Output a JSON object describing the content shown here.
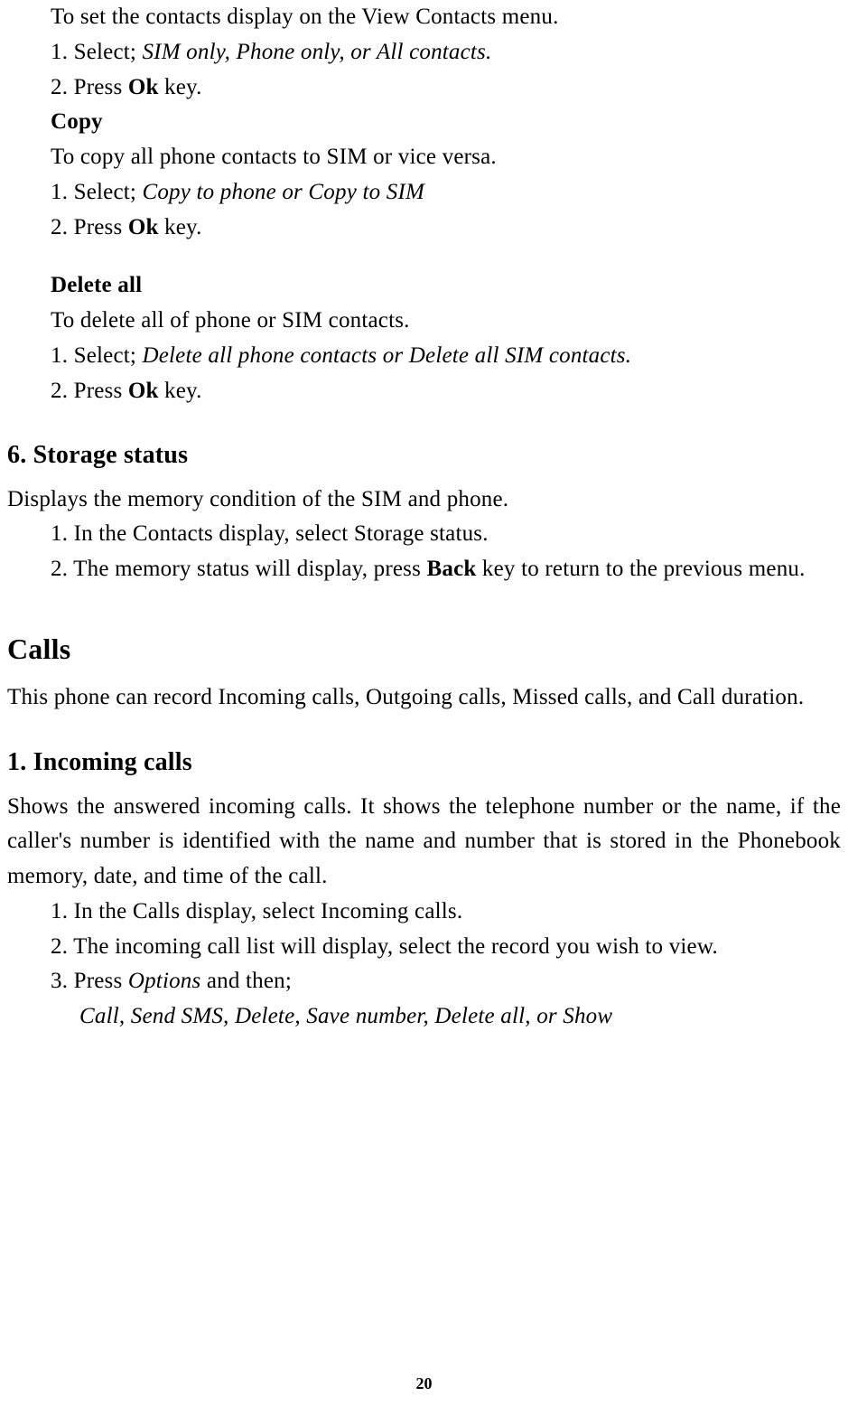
{
  "sec_view": {
    "intro": "To set the contacts display on the View Contacts menu.",
    "s1a": "1. Select; ",
    "s1b": "SIM only, Phone only, or All contacts.",
    "s2a": "2. Press ",
    "s2b": "Ok",
    "s2c": " key."
  },
  "copy": {
    "title": "Copy",
    "intro": "To copy all phone contacts to SIM or vice versa.",
    "s1a": "1. Select; ",
    "s1b": "Copy to phone or Copy to SIM",
    "s2a": "2. Press ",
    "s2b": "Ok",
    "s2c": " key."
  },
  "delete_all": {
    "title": "Delete all",
    "intro": "To delete all of phone or SIM contacts.",
    "s1a": "1. Select; ",
    "s1b": "Delete all phone contacts or Delete all SIM contacts.",
    "s2a": "2. Press ",
    "s2b": "Ok",
    "s2c": " key."
  },
  "storage": {
    "title": "6. Storage status",
    "intro": "Displays the memory condition of the SIM and phone.",
    "s1": "1. In the Contacts display, select Storage status.",
    "s2a": "2. The memory status will display, press ",
    "s2b": "Back",
    "s2c": " key to return to the previous menu."
  },
  "calls": {
    "title": "Calls",
    "intro": "This phone can record Incoming calls, Outgoing calls, Missed calls, and Call duration."
  },
  "incoming": {
    "title": "1. Incoming calls",
    "intro": "Shows the answered incoming calls. It shows the telephone number or the name, if the caller's number is identified with the name and number that is stored in the Phonebook memory, date, and time of the call.",
    "s1": "1. In the Calls display, select Incoming calls.",
    "s2": "2. The incoming call list will display, select the record you wish to view.",
    "s3a": "3. Press ",
    "s3b": "Options",
    "s3c": " and then;",
    "opts": "Call, Send SMS, Delete, Save number, Delete all, or Show"
  },
  "page_number": "20"
}
